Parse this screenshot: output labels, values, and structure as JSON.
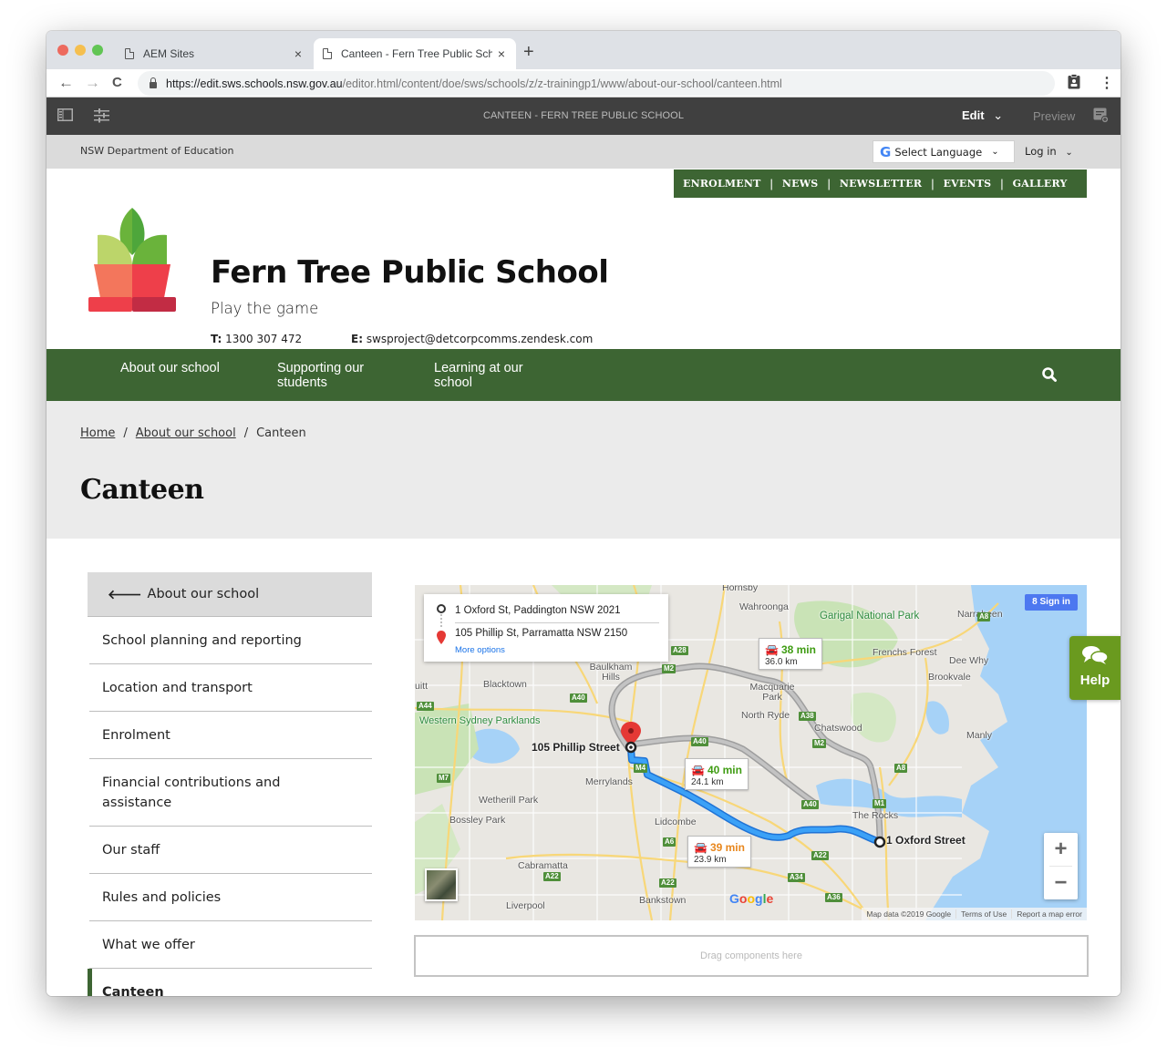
{
  "browser": {
    "tabs": [
      {
        "title": "AEM Sites",
        "active": false
      },
      {
        "title": "Canteen - Fern Tree Public Sch",
        "active": true
      }
    ],
    "new_tab_label": "+",
    "close_label": "×",
    "url_host": "https://edit.sws.schools.nsw.gov.au",
    "url_path": "/editor.html/content/doe/sws/schools/z/z-trainingp1/www/about-our-school/canteen.html",
    "nav": {
      "back": "←",
      "forward": "→",
      "reload": "C"
    }
  },
  "aem": {
    "page_title": "CANTEEN - FERN TREE PUBLIC SCHOOL",
    "mode_label": "Edit",
    "preview_label": "Preview"
  },
  "utility": {
    "department": "NSW Department of Education",
    "language_select": "Select Language",
    "login": "Log in"
  },
  "quick_links": [
    "ENROLMENT",
    "NEWS",
    "NEWSLETTER",
    "EVENTS",
    "GALLERY"
  ],
  "school": {
    "name": "Fern Tree Public School",
    "motto": "Play the game",
    "phone_label": "T:",
    "phone": "1300 307 472",
    "email_label": "E:",
    "email": "swsproject@detcorpcomms.zendesk.com"
  },
  "main_nav": [
    {
      "label": "About our school"
    },
    {
      "label": "Supporting our students"
    },
    {
      "label": "Learning at our school"
    }
  ],
  "breadcrumb": [
    {
      "label": "Home",
      "link": true
    },
    {
      "label": "About our school",
      "link": true
    },
    {
      "label": "Canteen",
      "link": false
    }
  ],
  "breadcrumb_separator": "/",
  "page": {
    "title": "Canteen"
  },
  "side_nav": {
    "back_label": "About our school",
    "items": [
      {
        "label": "School planning and reporting",
        "active": false
      },
      {
        "label": "Location and transport",
        "active": false
      },
      {
        "label": "Enrolment",
        "active": false
      },
      {
        "label": "Financial contributions and assistance",
        "active": false
      },
      {
        "label": "Our staff",
        "active": false
      },
      {
        "label": "Rules and policies",
        "active": false
      },
      {
        "label": "What we offer",
        "active": false
      },
      {
        "label": "Canteen",
        "active": true
      }
    ]
  },
  "map": {
    "origin": "1 Oxford St, Paddington NSW 2021",
    "destination": "105 Phillip St, Parramatta NSW 2150",
    "more_options": "More options",
    "sign_in": "Sign in",
    "routes": [
      {
        "time": "38 min",
        "distance": "36.0 km",
        "color": "#3f9c13"
      },
      {
        "time": "40 min",
        "distance": "24.1 km",
        "color": "#3f9c13"
      },
      {
        "time": "39 min",
        "distance": "23.9 km",
        "color": "#e8871e"
      }
    ],
    "pin_labels": {
      "destination": "105 Phillip Street",
      "origin": "1 Oxford Street"
    },
    "places": [
      "Hornsby",
      "Wahroonga",
      "Narrabeen",
      "Frenchs Forest",
      "Dee Why",
      "Brookvale",
      "Baulkham Hills",
      "Blacktown",
      "Macquarie Park",
      "North Ryde",
      "Chatswood",
      "Manly",
      "Merrylands",
      "Wetherill Park",
      "Bossley Park",
      "Lidcombe",
      "The Rocks",
      "Cabramatta",
      "Liverpool",
      "Bankstown",
      "uitt"
    ],
    "parks": [
      "Garigal National Park",
      "Western Sydney Parklands"
    ],
    "road_shields": [
      "A28",
      "M2",
      "A40",
      "A44",
      "A38",
      "M2",
      "A40",
      "M7",
      "M4",
      "A8",
      "A8",
      "M1",
      "A40",
      "A6",
      "A22",
      "A22",
      "A22",
      "A34",
      "A36"
    ],
    "attribution": [
      "Map data ©2019 Google",
      "Terms of Use",
      "Report a map error"
    ],
    "google": "Google",
    "zoom_in": "+",
    "zoom_out": "−"
  },
  "dropzone": {
    "label": "Drag components here"
  },
  "help": {
    "label": "Help"
  }
}
